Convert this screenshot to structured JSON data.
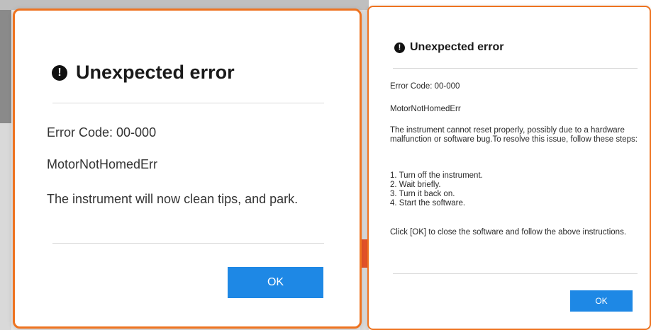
{
  "left_dialog": {
    "icon": "alert-icon",
    "icon_glyph": "!",
    "title": "Unexpected error",
    "error_code": "Error Code: 00-000",
    "error_name": "MotorNotHomedErr",
    "message": "The instrument will now clean tips, and park.",
    "ok_label": "OK"
  },
  "right_dialog": {
    "icon": "alert-icon",
    "icon_glyph": "!",
    "title": "Unexpected error",
    "error_code": "Error Code: 00-000",
    "error_name": "MotorNotHomedErr",
    "description": "The instrument cannot reset properly, possibly due to a hardware malfunction or software bug.To resolve this issue, follow these steps:",
    "steps": [
      "1. Turn off the instrument.",
      "2. Wait briefly.",
      "3. Turn it back on.",
      "4. Start the software."
    ],
    "close_instruction": "Click [OK] to close the software and follow the above instructions.",
    "ok_label": "OK"
  },
  "colors": {
    "dialog_border": "#ee7320",
    "button_bg": "#1e88e5",
    "button_text": "#ffffff",
    "divider": "#d9d9d9"
  }
}
